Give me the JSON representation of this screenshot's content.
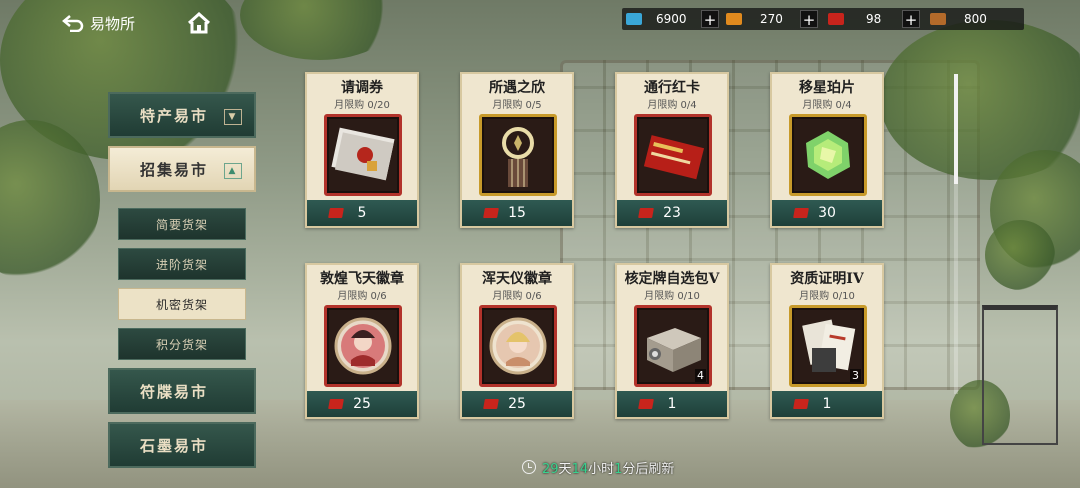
{
  "header": {
    "back_label": "易物所"
  },
  "resources": [
    {
      "icon": "blue-ticket-icon",
      "color": "#3aa7d8",
      "value": "6900"
    },
    {
      "icon": "orange-ticket-icon",
      "color": "#e08a1e",
      "value": "270"
    },
    {
      "icon": "red-card-icon",
      "color": "#c8241c",
      "value": "98"
    },
    {
      "icon": "chest-icon",
      "color": "#b36a2a",
      "value": "800"
    }
  ],
  "plus_label": "+",
  "nav": {
    "main": [
      {
        "label": "特产易市",
        "active": false
      },
      {
        "label": "招集易市",
        "active": true
      },
      {
        "label": "符牒易市",
        "active": false
      },
      {
        "label": "石墨易市",
        "active": false
      }
    ],
    "sub": [
      {
        "label": "简要货架",
        "active": false
      },
      {
        "label": "进阶货架",
        "active": false
      },
      {
        "label": "机密货架",
        "active": true
      },
      {
        "label": "积分货架",
        "active": false
      }
    ]
  },
  "cards": [
    {
      "name": "请调券",
      "limit": "月限购 0/20",
      "price": "5",
      "count": "",
      "frame": "red",
      "art": "envelope"
    },
    {
      "name": "所遇之欣",
      "limit": "月限购 0/5",
      "price": "15",
      "count": "",
      "frame": "gold",
      "art": "lamp"
    },
    {
      "name": "通行红卡",
      "limit": "月限购 0/4",
      "price": "23",
      "count": "",
      "frame": "red",
      "art": "redcard"
    },
    {
      "name": "移星珀片",
      "limit": "月限购 0/4",
      "price": "30",
      "count": "",
      "frame": "gold",
      "art": "gem"
    },
    {
      "name": "敦煌飞天徽章",
      "limit": "月限购 0/6",
      "price": "25",
      "count": "",
      "frame": "red",
      "art": "badge1"
    },
    {
      "name": "浑天仪徽章",
      "limit": "月限购 0/6",
      "price": "25",
      "count": "",
      "frame": "red",
      "art": "badge2"
    },
    {
      "name": "核定牌自选包V",
      "limit": "月限购 0/10",
      "price": "1",
      "count": "4",
      "frame": "red",
      "art": "box"
    },
    {
      "name": "资质证明IV",
      "limit": "月限购 0/10",
      "price": "1",
      "count": "3",
      "frame": "gold",
      "art": "docs"
    }
  ],
  "refresh": {
    "days": "29",
    "days_unit": "天",
    "hours": "14",
    "hours_unit": "小时",
    "minutes": "1",
    "suffix": "分后刷新"
  }
}
